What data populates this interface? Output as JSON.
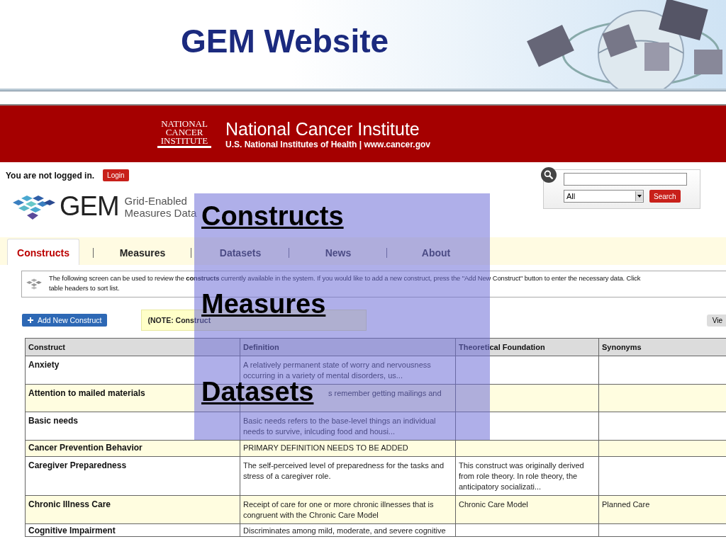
{
  "slide": {
    "title": "GEM Website"
  },
  "banner": {
    "logo_lines": [
      "NATIONAL",
      "CANCER",
      "INSTITUTE"
    ],
    "name": "National Cancer Institute",
    "subtitle": "U.S. National Institutes of Health  |  www.cancer.gov"
  },
  "login": {
    "status": "You are not logged in.",
    "button": "Login"
  },
  "gem_logo": {
    "mark": "GEM",
    "line_1": "Grid-Enabled",
    "line_2": "Measures Data"
  },
  "search": {
    "scope": "All",
    "button": "Search"
  },
  "tabs": [
    {
      "label": "Constructs",
      "selected": true
    },
    {
      "label": "Measures",
      "selected": false
    },
    {
      "label": "Datasets",
      "selected": false
    },
    {
      "label": "News",
      "selected": false
    },
    {
      "label": "About",
      "selected": false
    }
  ],
  "info": {
    "lines": [
      "The following screen can be used to review the **constructs** currently available in the system. If you would like to add a new construct, press the \"Add New Construct\" button to enter the necessary data. Click",
      "table headers to sort list."
    ]
  },
  "actions": {
    "add_button": "Add New Construct",
    "note": "(NOTE: Construct",
    "view_button": "Vie"
  },
  "table": {
    "columns": [
      "Construct",
      "Definition",
      "Theoretical Foundation",
      "Synonyms"
    ],
    "rows": [
      {
        "construct": "Anxiety",
        "definition": "A relatively permanent state of worry and nervousness occurring in a variety of mental disorders, us...",
        "foundation": "",
        "synonyms": ""
      },
      {
        "construct": "Attention to mailed materials",
        "definition": "s remember getting mailings and",
        "foundation": "",
        "synonyms": ""
      },
      {
        "construct": "Basic needs",
        "definition": "Basic needs refers to the base-level things an individual needs to survive, inlcuding food and housi...",
        "foundation": "",
        "synonyms": ""
      },
      {
        "construct": "Cancer Prevention Behavior",
        "definition": "PRIMARY DEFINITION NEEDS TO BE ADDED",
        "foundation": "",
        "synonyms": ""
      },
      {
        "construct": "Caregiver Preparedness",
        "definition": "The self-perceived level of preparedness for the tasks and stress of a caregiver role.",
        "foundation": "This construct was originally derived from role theory. In role theory, the anticipatory socializati...",
        "synonyms": ""
      },
      {
        "construct": "Chronic Illness Care",
        "definition": "Receipt of care for one or more chronic illnesses that is congruent with the Chronic Care Model",
        "foundation": "Chronic Care Model",
        "synonyms": "Planned Care"
      },
      {
        "construct": "Cognitive Impairment",
        "definition": "Discriminates among mild, moderate, and severe cognitive",
        "foundation": "",
        "synonyms": ""
      }
    ]
  },
  "overlay": {
    "links": [
      "Constructs",
      "Measures",
      "Datasets"
    ]
  }
}
